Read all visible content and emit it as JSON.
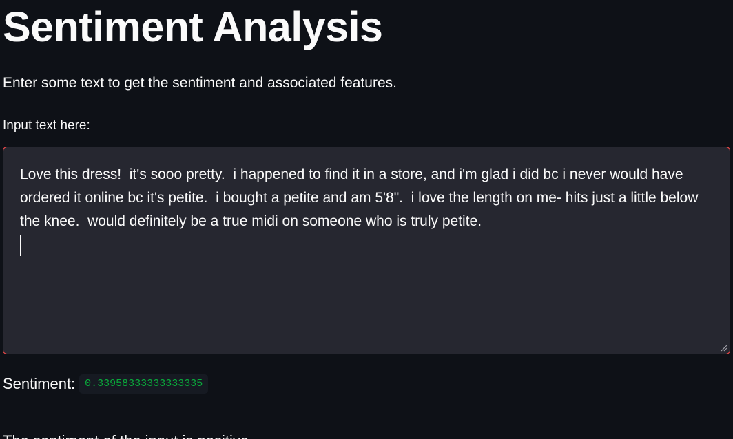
{
  "header": {
    "title": "Sentiment Analysis"
  },
  "main": {
    "description": "Enter some text to get the sentiment and associated features.",
    "input": {
      "label": "Input text here:",
      "value": "Love this dress!  it's sooo pretty.  i happened to find it in a store, and i'm glad i did bc i never would have ordered it online bc it's petite.  i bought a petite and am 5'8\".  i love the length on me- hits just a little below the knee.  would definitely be a true midi on someone who is truly petite.",
      "border_color": "#ff4b4b",
      "background": "#262730"
    },
    "sentiment": {
      "label": "Sentiment:",
      "value": "0.33958333333333335",
      "value_color": "#09ab3b"
    },
    "result_text": "The sentiment of the input is positive."
  },
  "theme": {
    "background": "#0e1117",
    "text": "#fafafa"
  },
  "icons": {
    "resize_handle": "resize-grip-icon"
  }
}
